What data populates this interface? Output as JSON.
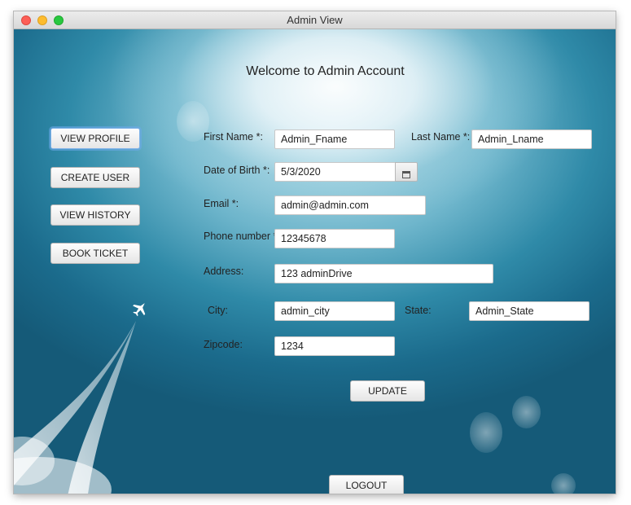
{
  "window": {
    "title": "Admin View"
  },
  "heading": "Welcome to Admin Account",
  "sidebar": {
    "buttons": [
      {
        "label": "VIEW PROFILE"
      },
      {
        "label": "CREATE USER"
      },
      {
        "label": "VIEW HISTORY"
      },
      {
        "label": "BOOK TICKET"
      }
    ]
  },
  "form": {
    "first_name": {
      "label": "First Name *:",
      "value": "Admin_Fname"
    },
    "last_name": {
      "label": "Last Name *:",
      "value": "Admin_Lname"
    },
    "dob": {
      "label": "Date of Birth *:",
      "value": "5/3/2020"
    },
    "email": {
      "label": "Email *:",
      "value": "admin@admin.com"
    },
    "phone": {
      "label": "Phone number *",
      "value": "12345678"
    },
    "address": {
      "label": "Address:",
      "value": "123 adminDrive"
    },
    "city": {
      "label": "City:",
      "value": "admin_city"
    },
    "state": {
      "label": "State:",
      "value": "Admin_State"
    },
    "zipcode": {
      "label": "Zipcode:",
      "value": "1234"
    }
  },
  "buttons": {
    "update": "UPDATE",
    "logout": "LOGOUT"
  },
  "icons": {
    "calendar": "calendar-icon",
    "plane": "airplane-icon"
  }
}
